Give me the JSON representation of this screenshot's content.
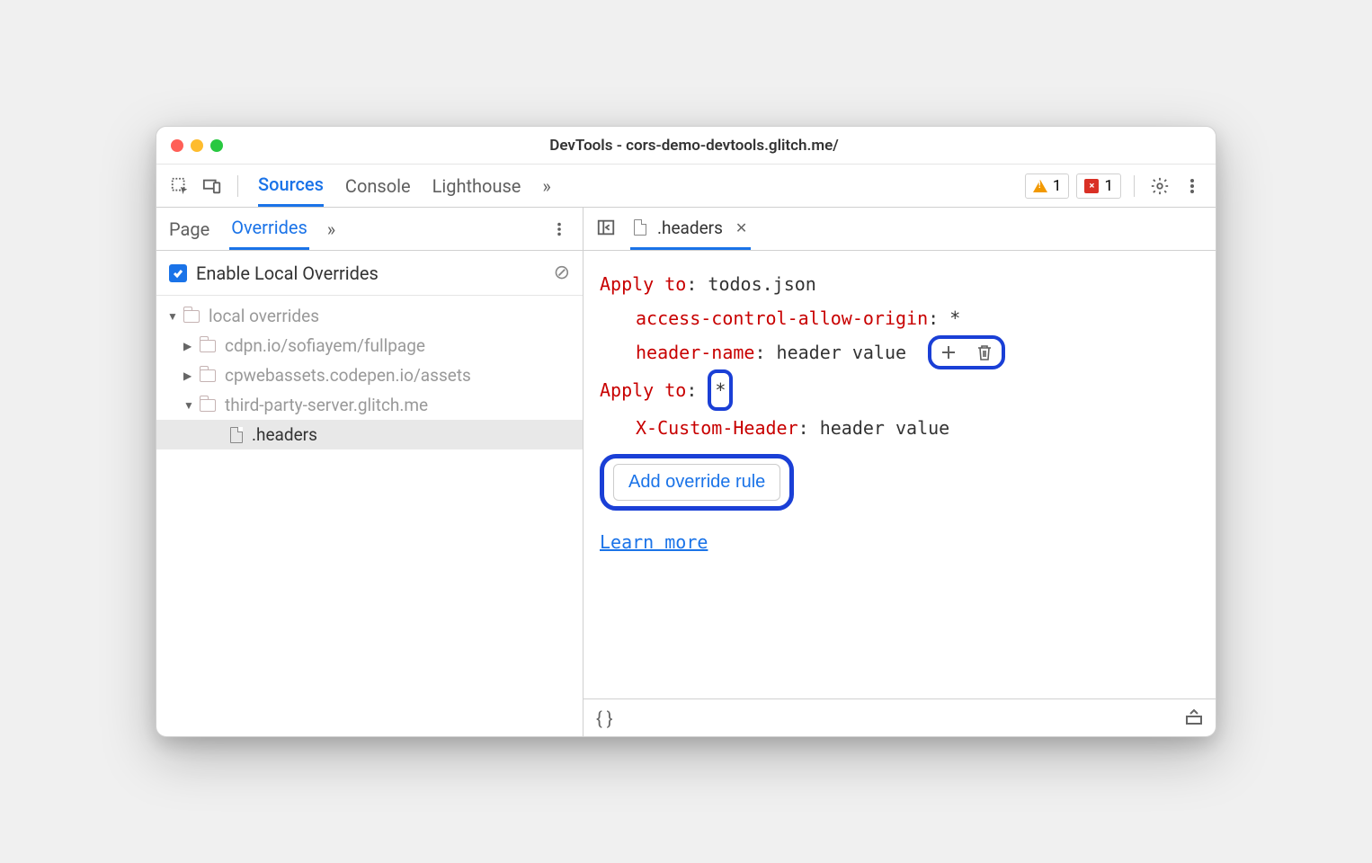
{
  "window": {
    "title": "DevTools - cors-demo-devtools.glitch.me/"
  },
  "toolbar": {
    "tabs": [
      "Sources",
      "Console",
      "Lighthouse"
    ],
    "active_tab": "Sources",
    "warn_count": "1",
    "error_count": "1"
  },
  "sidebar": {
    "tabs": [
      "Page",
      "Overrides"
    ],
    "active_tab": "Overrides",
    "enable_label": "Enable Local Overrides",
    "tree": {
      "root": "local overrides",
      "folders": [
        "cdpn.io/sofiayem/fullpage",
        "cpwebassets.codepen.io/assets",
        "third-party-server.glitch.me"
      ],
      "file": ".headers"
    }
  },
  "file_tab": {
    "name": ".headers"
  },
  "editor": {
    "apply_label": "Apply to",
    "rule1_target": "todos.json",
    "rule1_headers": [
      {
        "name": "access-control-allow-origin",
        "value": "*"
      },
      {
        "name": "header-name",
        "value": "header value"
      }
    ],
    "rule2_target": "*",
    "rule2_headers": [
      {
        "name": "X-Custom-Header",
        "value": "header value"
      }
    ],
    "add_rule_label": "Add override rule",
    "learn_more": "Learn more"
  }
}
